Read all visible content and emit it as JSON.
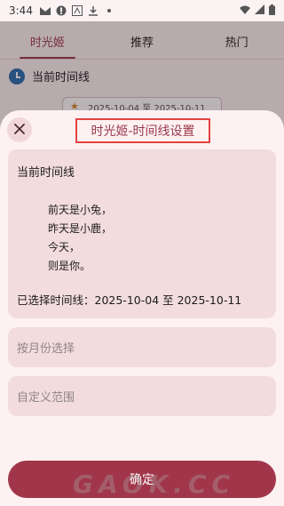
{
  "status_bar": {
    "time": "3:44"
  },
  "tabs": [
    {
      "label": "时光姬",
      "active": true
    },
    {
      "label": "推荐",
      "active": false
    },
    {
      "label": "热门",
      "active": false
    }
  ],
  "background": {
    "section_title": "当前时间线",
    "range_chip": "2025-10-04 至 2025-10-11"
  },
  "sheet": {
    "title": "时光姬-时间线设置",
    "card_title": "当前时间线",
    "poem": [
      "前天是小兔，",
      "昨天是小鹿，",
      "今天，",
      "则是你。"
    ],
    "selected_range": "已选择时间线：2025-10-04 至 2025-10-11",
    "month_select_label": "按月份选择",
    "custom_range_label": "自定义范围",
    "confirm_label": "确定"
  },
  "watermark": "GAOK.CC",
  "colors": {
    "accent": "#9b3a4c",
    "confirm": "#a1364a",
    "title_highlight": "#e3423f",
    "card": "#f2dcdd"
  }
}
